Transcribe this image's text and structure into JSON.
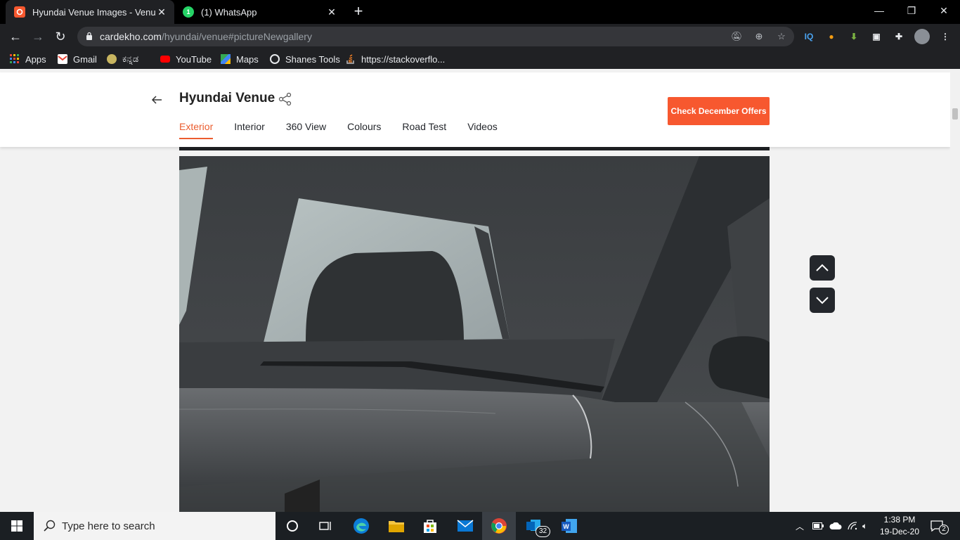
{
  "browser": {
    "tabs": [
      {
        "title": "Hyundai Venue Images - Venue I",
        "active": true
      },
      {
        "title": "(1) WhatsApp",
        "active": false
      }
    ],
    "url_host": "cardekho.com",
    "url_path": "/hyundai/venue#pictureNewgallery",
    "bookmarks": [
      "Apps",
      "Gmail",
      "ಕನ್ನಡ",
      "YouTube",
      "Maps",
      "Shanes Tools",
      "https://stackoverflo..."
    ],
    "extension_iq_label": "IQ"
  },
  "page": {
    "car_title": "Hyundai Venue",
    "tabs": [
      "Exterior",
      "Interior",
      "360 View",
      "Colours",
      "Road Test",
      "Videos"
    ],
    "active_tab": "Exterior",
    "offers_button": "Check December Offers",
    "accent_color": "#f7582f"
  },
  "taskbar": {
    "search_placeholder": "Type here to search",
    "outlook_badge": "32",
    "time": "1:38 PM",
    "date": "19-Dec-20",
    "notification_count": "2"
  }
}
